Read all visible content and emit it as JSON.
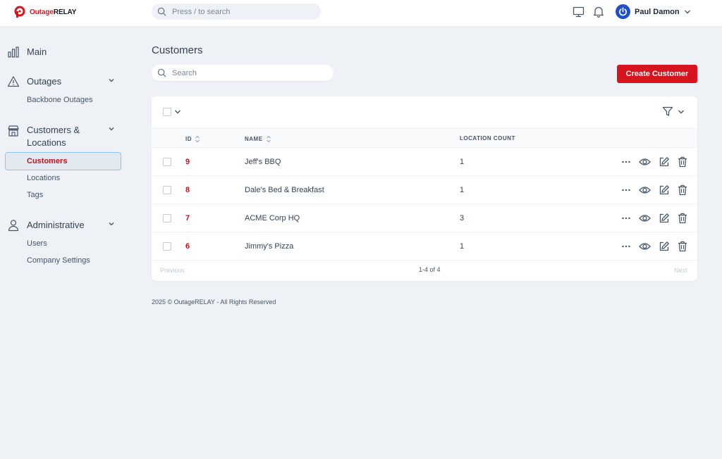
{
  "brand": {
    "name_prefix": "Outage",
    "name_suffix": "RELAY",
    "accent": "#d7141d"
  },
  "topbar": {
    "search_placeholder": "Press / to search",
    "user_name": "Paul Damon"
  },
  "sidebar": {
    "main": "Main",
    "outages": "Outages",
    "backbone_outages": "Backbone Outages",
    "customers_locations_line1": "Customers &",
    "customers_locations_line2": "Locations",
    "customers": "Customers",
    "locations": "Locations",
    "tags": "Tags",
    "administrative": "Administrative",
    "users": "Users",
    "company_settings": "Company Settings"
  },
  "page": {
    "title": "Customers",
    "search_placeholder": "Search",
    "create_button": "Create Customer"
  },
  "table": {
    "headers": {
      "id": "ID",
      "name": "NAME",
      "location_count": "LOCATION COUNT"
    },
    "rows": [
      {
        "id": "9",
        "name": "Jeff's BBQ",
        "location_count": "1"
      },
      {
        "id": "8",
        "name": "Dale's Bed & Breakfast",
        "location_count": "1"
      },
      {
        "id": "7",
        "name": "ACME Corp HQ",
        "location_count": "3"
      },
      {
        "id": "6",
        "name": "Jimmy's Pizza",
        "location_count": "1"
      }
    ],
    "pagination": {
      "previous": "Previous",
      "range": "1-4 of 4",
      "next": "Next"
    }
  },
  "footer": "2025 © OutageRELAY - All Rights Reserved"
}
